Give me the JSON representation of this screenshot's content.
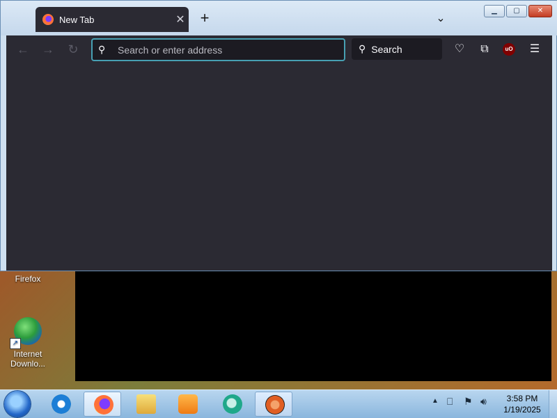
{
  "browser": {
    "tab": {
      "title": "New Tab"
    },
    "urlbar": {
      "placeholder": "Search or enter address"
    },
    "searchbar": {
      "label": "Search"
    },
    "toolbar_icons": [
      "back-icon",
      "forward-icon",
      "reload-icon",
      "pocket-icon",
      "extensions-icon",
      "ublock-icon",
      "menu-icon"
    ]
  },
  "desktop": {
    "icons": [
      {
        "label": "Firefox"
      },
      {
        "label_line1": "Internet",
        "label_line2": "Downlo..."
      }
    ]
  },
  "taskbar": {
    "clock": {
      "time": "3:58 PM",
      "date": "1/19/2025"
    },
    "apps": [
      "start-button",
      "internet-explorer",
      "firefox",
      "file-explorer",
      "media-player",
      "app-teal",
      "app-q"
    ]
  },
  "colors": {
    "browser_bg": "#2b2a33",
    "urlbar_border": "#47a0b3",
    "taskbar": "#8ab6dd"
  }
}
